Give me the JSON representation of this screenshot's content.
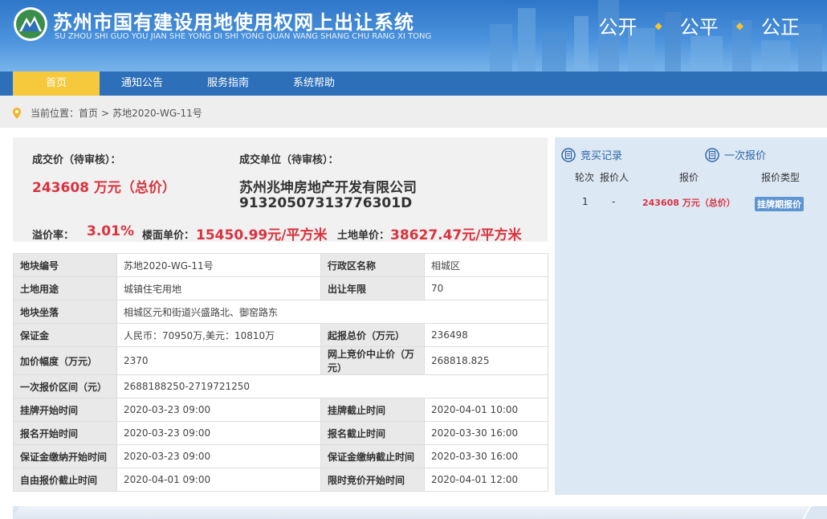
{
  "header": {
    "title": "苏州市国有建设用地使用权网上出让系统",
    "subtitle": "SU ZHOU SHI GUO YOU JIAN SHE YONG DI SHI YONG QUAN WANG SHANG CHU RANG XI TONG",
    "slogans": [
      "公开",
      "公平",
      "公正"
    ],
    "slogan_dot": "◆"
  },
  "nav": {
    "items": [
      {
        "label": "首页",
        "active": true
      },
      {
        "label": "通知公告",
        "active": false
      },
      {
        "label": "服务指南",
        "active": false
      },
      {
        "label": "系统帮助",
        "active": false
      }
    ]
  },
  "breadcrumb": {
    "prefix": "当前位置：",
    "home": "首页",
    "separator": ">",
    "current": "苏地2020-WG-11号"
  },
  "summary": {
    "price_label": "成交价（待审核）：",
    "price_value": "243608 万元（总价）",
    "buyer_label": "成交单位（待审核）：",
    "buyer_name": "苏州兆坤房地产开发有限公司",
    "buyer_code": "91320507313776301D",
    "premium_label": "溢价率：",
    "premium_value": "3.01%",
    "floor_price_label": "楼面单价：",
    "floor_price_value": "15450.99元/平方米",
    "land_price_label": "土地单价：",
    "land_price_value": "38627.47元/平方米"
  },
  "details": {
    "rows": [
      {
        "k1": "地块编号",
        "v1": "苏地2020-WG-11号",
        "k2": "行政区名称",
        "v2": "相城区"
      },
      {
        "k1": "土地用途",
        "v1": "城镇住宅用地",
        "k2": "出让年限",
        "v2": "70"
      },
      {
        "k1": "地块坐落",
        "v1": "相城区元和街道兴盛路北、御窑路东"
      },
      {
        "k1": "保证金",
        "v1": "人民币：70950万,美元：10810万",
        "k2": "起报总价（万元）",
        "v2": "236498"
      },
      {
        "k1": "加价幅度（万元）",
        "v1": "2370",
        "k2": "网上竞价中止价（万元）",
        "v2": "268818.825"
      },
      {
        "k1": "一次报价区间（元）",
        "v1": "2688188250-2719721250"
      },
      {
        "k1": "挂牌开始时间",
        "v1": "2020-03-23 09:00",
        "k2": "挂牌截止时间",
        "v2": "2020-04-01 10:00"
      },
      {
        "k1": "报名开始时间",
        "v1": "2020-03-23 09:00",
        "k2": "报名截止时间",
        "v2": "2020-03-30 16:00"
      },
      {
        "k1": "保证金缴纳开始时间",
        "v1": "2020-03-23 09:00",
        "k2": "保证金缴纳截止时间",
        "v2": "2020-03-30 16:00"
      },
      {
        "k1": "自由报价截止时间",
        "v1": "2020-04-01 09:00",
        "k2": "限时竞价开始时间",
        "v2": "2020-04-01 12:00"
      }
    ]
  },
  "side": {
    "tab_records": "竞买记录",
    "tab_quote": "一次报价",
    "columns": [
      "轮次",
      "报价人",
      "报价",
      "报价类型"
    ],
    "row": {
      "round": "1",
      "bidder": "-",
      "price": "243608 万元（总价）",
      "type": "挂牌期报价"
    }
  },
  "colors": {
    "accent_red": "#d9333f",
    "nav_blue": "#2d6fb8",
    "nav_active": "#f5c93b",
    "side_bg": "#dde8f5"
  }
}
